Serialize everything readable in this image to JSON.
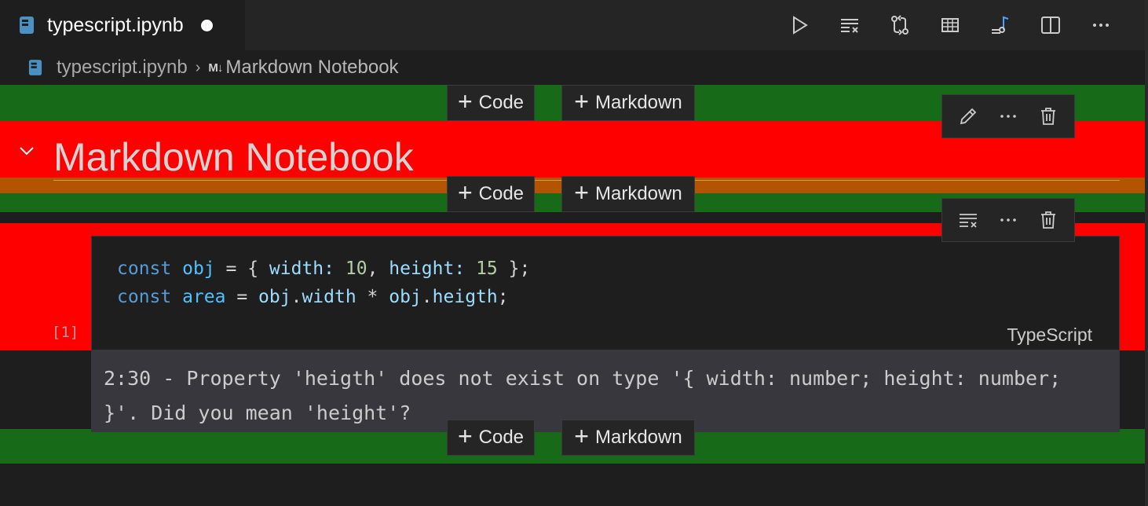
{
  "tab": {
    "title": "typescript.ipynb"
  },
  "breadcrumb": {
    "file": "typescript.ipynb",
    "md_badge": "M↓",
    "section": "Markdown Notebook"
  },
  "add_buttons": {
    "code_label": "Code",
    "markdown_label": "Markdown"
  },
  "markdown_cell": {
    "heading": "Markdown Notebook"
  },
  "code_cell": {
    "execution_count": "[1]",
    "language": "TypeScript",
    "line1": {
      "t1": "const",
      "t2": "obj",
      "t3": " = { ",
      "t4": "width",
      "t5": ": ",
      "t6": "10",
      "t7": ", ",
      "t8": "height",
      "t9": ": ",
      "t10": "15",
      "t11": " };"
    },
    "line2": {
      "t1": "const",
      "t2": "area",
      "t3": " = ",
      "t4": "obj",
      "t5": ".",
      "t6": "width",
      "t7": " * ",
      "t8": "obj",
      "t9": ".",
      "t10": "heigth",
      "t11": ";"
    }
  },
  "output": {
    "text": "2:30 - Property 'heigth' does not exist on type '{ width: number; height: number; }'. Did you mean 'height'?"
  },
  "colors": {
    "green_band": "#176a17",
    "red_band": "#ff0000",
    "orange_band": "#b35500"
  }
}
